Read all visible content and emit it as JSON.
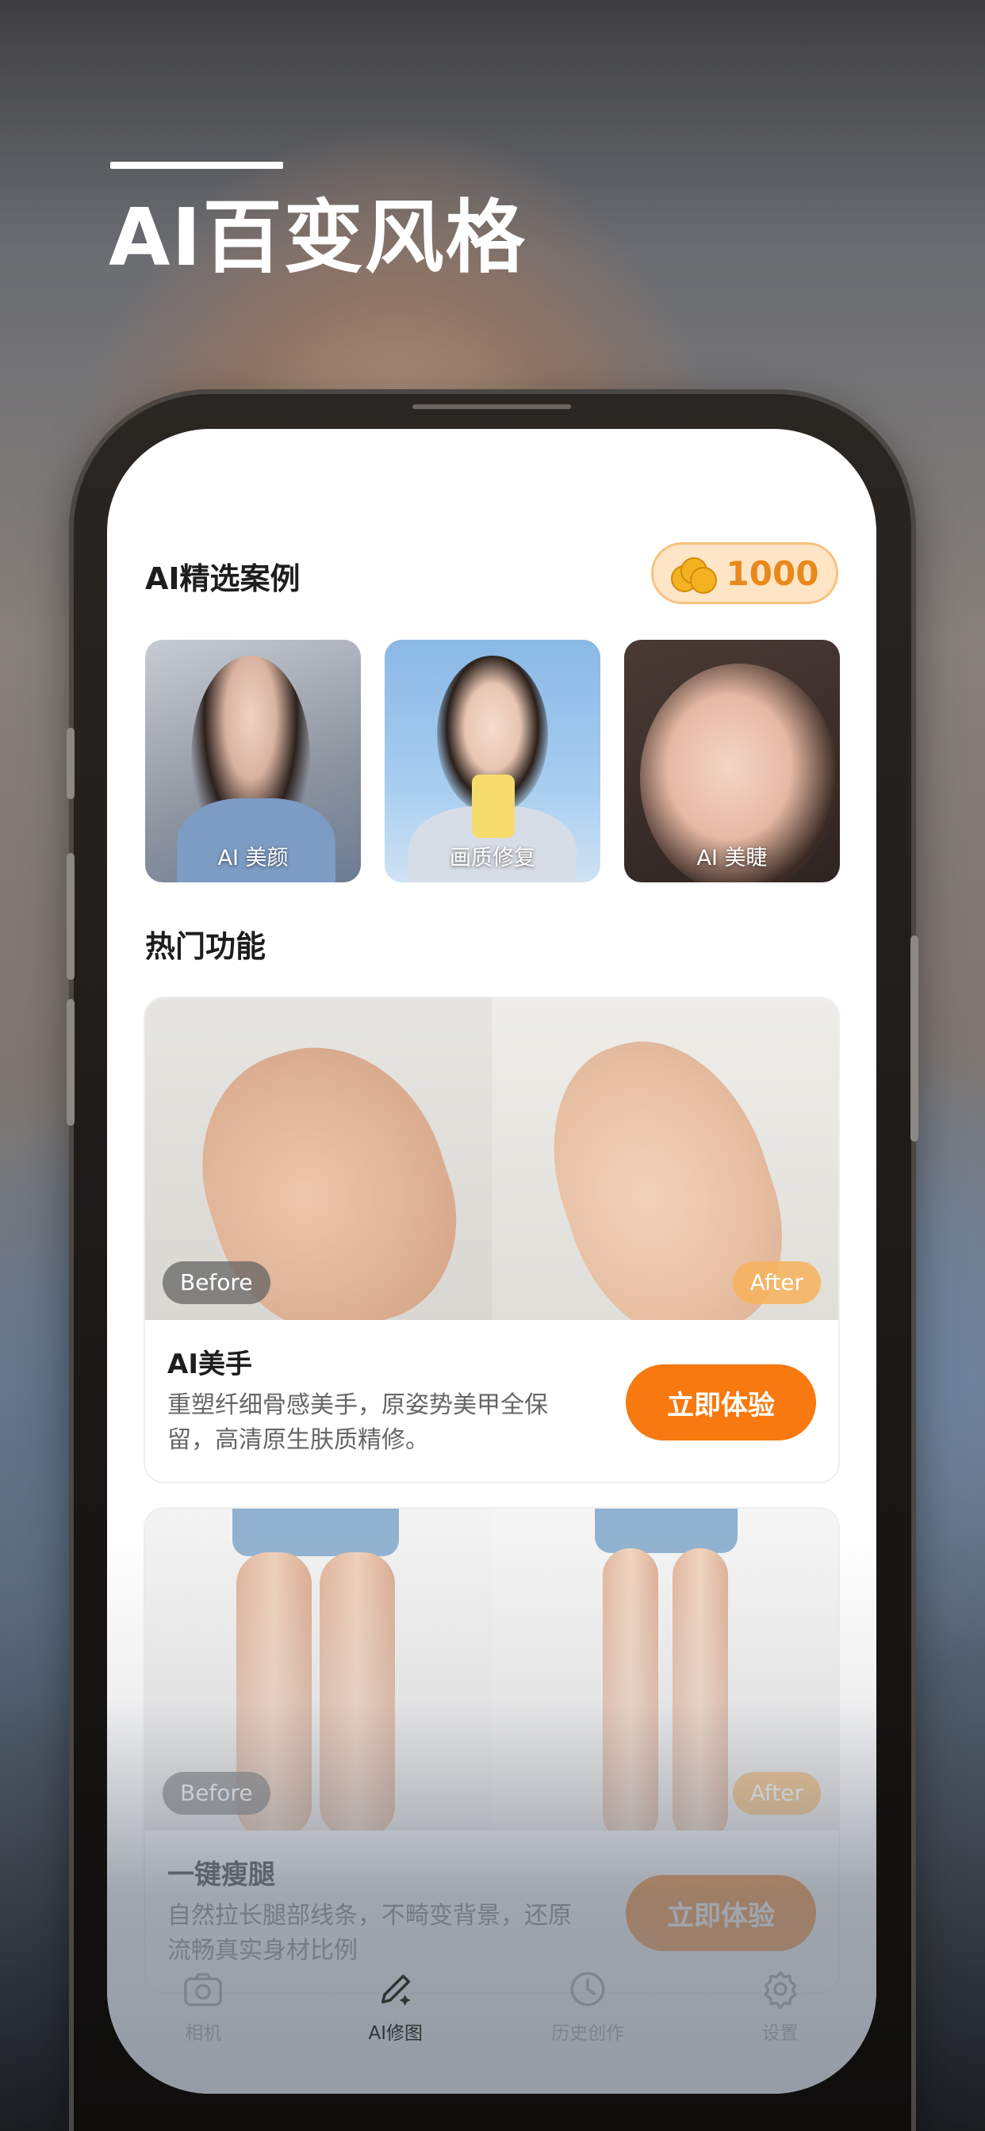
{
  "hero": {
    "title": "AI百变风格"
  },
  "selected_cases": {
    "title": "AI精选案例",
    "coins": "1000",
    "items": [
      {
        "label": "AI 美颜"
      },
      {
        "label": "画质修复"
      },
      {
        "label": "AI 美睫"
      }
    ]
  },
  "hot_features": {
    "title": "热门功能",
    "cards": [
      {
        "before": "Before",
        "after": "After",
        "title": "AI美手",
        "desc": "重塑纤细骨感美手，原姿势美甲全保留，高清原生肤质精修。",
        "button": "立即体验"
      },
      {
        "before": "Before",
        "after": "After",
        "title": "一键瘦腿",
        "desc": "自然拉长腿部线条，不畸变背景，还原流畅真实身材比例",
        "button": "立即体验"
      }
    ]
  },
  "tabbar": {
    "items": [
      {
        "label": "相机",
        "icon": "camera-icon"
      },
      {
        "label": "AI修图",
        "icon": "brush-icon"
      },
      {
        "label": "历史创作",
        "icon": "history-icon"
      },
      {
        "label": "设置",
        "icon": "gear-icon"
      }
    ]
  },
  "colors": {
    "accent": "#f7790f",
    "coin_bg": "#fde5c6",
    "coin_text": "#e9891b"
  }
}
